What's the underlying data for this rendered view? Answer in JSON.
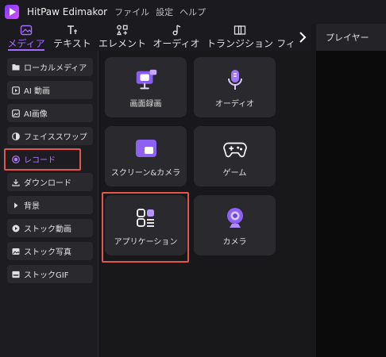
{
  "app": {
    "title": "HitPaw Edimakor",
    "menu": [
      "ファイル",
      "設定",
      "ヘルプ"
    ]
  },
  "tabs": [
    {
      "label": "メディア",
      "icon": "image-icon",
      "active": true
    },
    {
      "label": "テキスト",
      "icon": "text-icon",
      "active": false
    },
    {
      "label": "エレメント",
      "icon": "elements-icon",
      "active": false
    },
    {
      "label": "オーディオ",
      "icon": "music-note-icon",
      "active": false
    },
    {
      "label": "トランジション",
      "icon": "transition-icon",
      "active": false
    },
    {
      "label": "フィ",
      "icon": "",
      "active": false
    }
  ],
  "player": {
    "label": "プレイヤー"
  },
  "sidebar": {
    "items": [
      {
        "label": "ローカルメディア",
        "icon": "folder-icon"
      },
      {
        "label": "AI 動画",
        "icon": "ai-video-icon"
      },
      {
        "label": "AI画像",
        "icon": "ai-image-icon"
      },
      {
        "label": "フェイススワップ",
        "icon": "face-swap-icon"
      },
      {
        "label": "レコード",
        "icon": "record-icon",
        "active": true
      },
      {
        "label": "ダウンロード",
        "icon": "download-icon"
      },
      {
        "label": "背景",
        "icon": "background-icon"
      },
      {
        "label": "ストック動画",
        "icon": "stock-video-icon"
      },
      {
        "label": "ストック写真",
        "icon": "stock-photo-icon"
      },
      {
        "label": "ストックGIF",
        "icon": "gif-icon"
      }
    ]
  },
  "cards": [
    {
      "label": "画面録画",
      "icon": "monitor-record-icon"
    },
    {
      "label": "オーディオ",
      "icon": "microphone-icon"
    },
    {
      "label": "スクリーン&カメラ",
      "icon": "screen-camera-icon"
    },
    {
      "label": "ゲーム",
      "icon": "gamepad-icon"
    },
    {
      "label": "アプリケーション",
      "icon": "apps-icon"
    },
    {
      "label": "カメラ",
      "icon": "webcam-icon"
    }
  ],
  "colors": {
    "accent": "#a46cff",
    "highlight": "#e2564c"
  }
}
